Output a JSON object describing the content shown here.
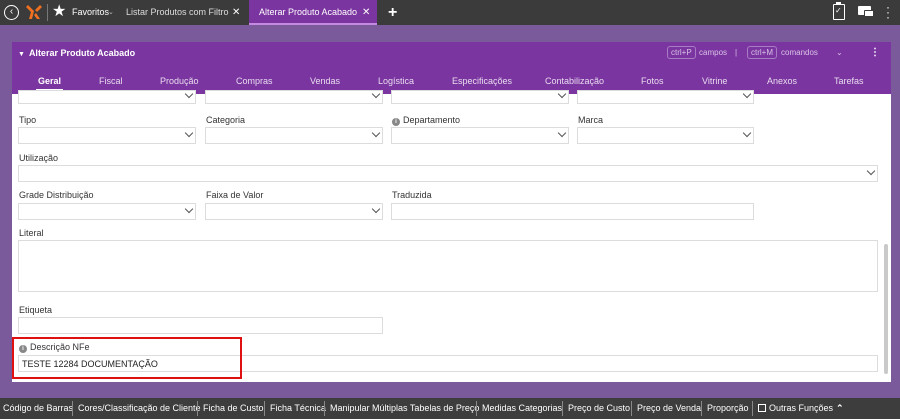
{
  "topbar": {
    "favorites_label": "Favoritos",
    "tabs": [
      {
        "label": "Listar Produtos com Filtro"
      },
      {
        "label": "Alterar Produto Acabado"
      }
    ]
  },
  "panel": {
    "title": "Alterar Produto Acabado",
    "shortcut_fields_key": "ctrl+P",
    "shortcut_fields_label": "campos",
    "shortcut_separator": "|",
    "shortcut_commands_key": "ctrl+M",
    "shortcut_commands_label": "comandos",
    "nav_tabs": [
      "Geral",
      "Fiscal",
      "Produção",
      "Compras",
      "Vendas",
      "Logística",
      "Especificações",
      "Contabilização",
      "Fotos",
      "Vitrine",
      "Anexos",
      "Tarefas"
    ],
    "active_tab": "Geral"
  },
  "form": {
    "tipo_label": "Tipo",
    "categoria_label": "Categoria",
    "departamento_label": "Departamento",
    "marca_label": "Marca",
    "utilizacao_label": "Utilização",
    "grade_label": "Grade Distribuição",
    "faixa_label": "Faixa de Valor",
    "traduzida_label": "Traduzida",
    "literal_label": "Literal",
    "etiqueta_label": "Etiqueta",
    "descricao_nfe_label": "Descrição NFe",
    "descricao_nfe_value": "TESTE 12284 DOCUMENTAÇÃO"
  },
  "bottombar": {
    "buttons": [
      "Código de Barras",
      "Cores/Classificação de Cliente",
      "Ficha de Custo",
      "Ficha Técnica",
      "Manipular Múltiplas Tabelas de Preço",
      "Medidas Categorias",
      "Preço de Custo",
      "Preço de Venda",
      "Proporção"
    ],
    "more_label": "Outras Funções"
  },
  "colors": {
    "accent_purple": "#7b35a0",
    "topbar_bg": "#3b3b3b",
    "highlight_border": "#e01010"
  }
}
